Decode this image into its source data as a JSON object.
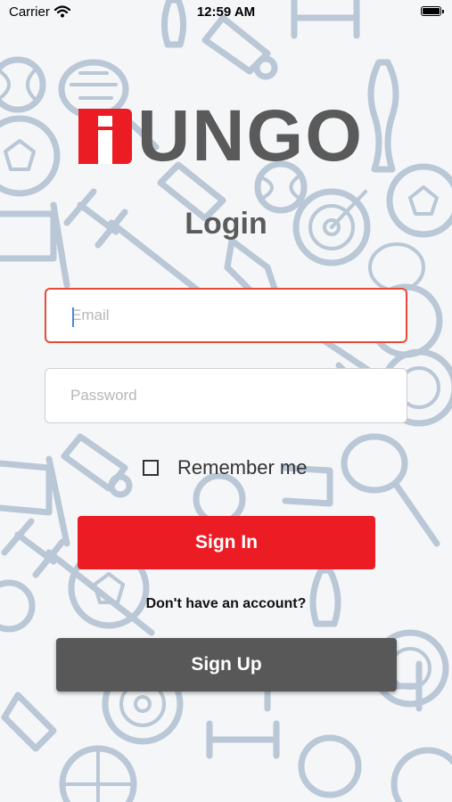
{
  "status_bar": {
    "carrier": "Carrier",
    "time": "12:59 AM",
    "wifi_icon": "wifi-icon",
    "battery_icon": "battery-icon"
  },
  "brand": {
    "logo_text": "UNGO",
    "logo_color": "#ec1c24",
    "text_color": "#5a5a5a"
  },
  "login": {
    "title": "Login",
    "email": {
      "placeholder": "Email",
      "value": ""
    },
    "password": {
      "placeholder": "Password",
      "value": ""
    },
    "remember_me": {
      "label": "Remember me",
      "checked": false
    },
    "sign_in_label": "Sign In",
    "no_account_text": "Don't have an account?",
    "sign_up_label": "Sign Up"
  },
  "colors": {
    "accent": "#ec1c24",
    "secondary_button": "#585858",
    "field_focus_border": "#e8493a",
    "background_pattern": "#b9c7d6"
  },
  "background": {
    "pattern": "sports-doodle-pattern"
  }
}
